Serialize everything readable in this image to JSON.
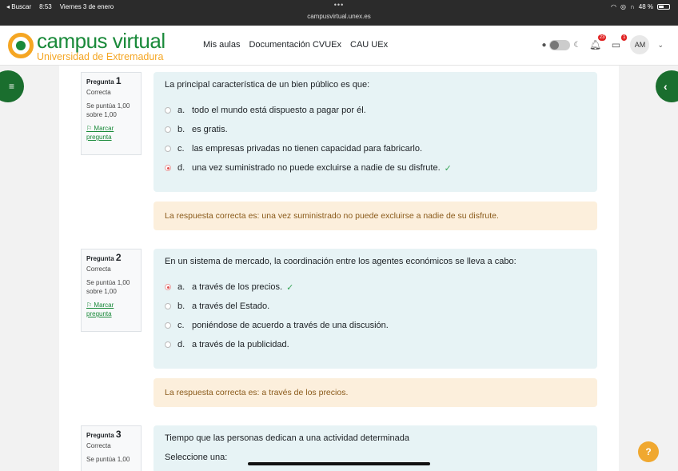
{
  "status_bar": {
    "back_app": "◂ Buscar",
    "time": "8:53",
    "date": "Viernes 3 de enero",
    "url": "campusvirtual.unex.es",
    "battery": "48 %",
    "battery_level": 0.48
  },
  "header": {
    "logo_title": "campus virtual",
    "logo_subtitle": "Universidad de Extremadura",
    "nav": [
      "Mis aulas",
      "Documentación CVUEx",
      "CAU UEx"
    ],
    "notifications_badge": "23",
    "messages_badge": "1",
    "avatar_initials": "AM"
  },
  "questions": [
    {
      "label": "Pregunta",
      "number": "1",
      "state": "Correcta",
      "grade": "Se puntúa 1,00 sobre 1,00",
      "flag": "Marcar pregunta",
      "text": "La principal característica de un bien público es que:",
      "answers": [
        {
          "letter": "a.",
          "text": "todo el mundo está dispuesto a pagar por él."
        },
        {
          "letter": "b.",
          "text": "es gratis."
        },
        {
          "letter": "c.",
          "text": "las empresas privadas no tienen capacidad para fabricarlo."
        },
        {
          "letter": "d.",
          "text": "una vez suministrado no puede excluirse a nadie de su disfrute."
        }
      ],
      "feedback": "La respuesta correcta es: una vez suministrado no puede excluirse a nadie de su disfrute."
    },
    {
      "label": "Pregunta",
      "number": "2",
      "state": "Correcta",
      "grade": "Se puntúa 1,00 sobre 1,00",
      "flag": "Marcar pregunta",
      "text": "En un sistema de mercado, la coordinación entre los agentes económicos se lleva a cabo:",
      "answers": [
        {
          "letter": "a.",
          "text": "a través de los precios."
        },
        {
          "letter": "b.",
          "text": "a través del Estado."
        },
        {
          "letter": "c.",
          "text": "poniéndose de acuerdo a través de una discusión."
        },
        {
          "letter": "d.",
          "text": "a través de la publicidad."
        }
      ],
      "feedback": "La respuesta correcta es: a través de los precios."
    },
    {
      "label": "Pregunta",
      "number": "3",
      "state": "Correcta",
      "grade": "Se puntúa 1,00",
      "text": "Tiempo que las personas dedican a una actividad determinada",
      "select_prompt": "Seleccione una:"
    }
  ],
  "help_label": "?"
}
